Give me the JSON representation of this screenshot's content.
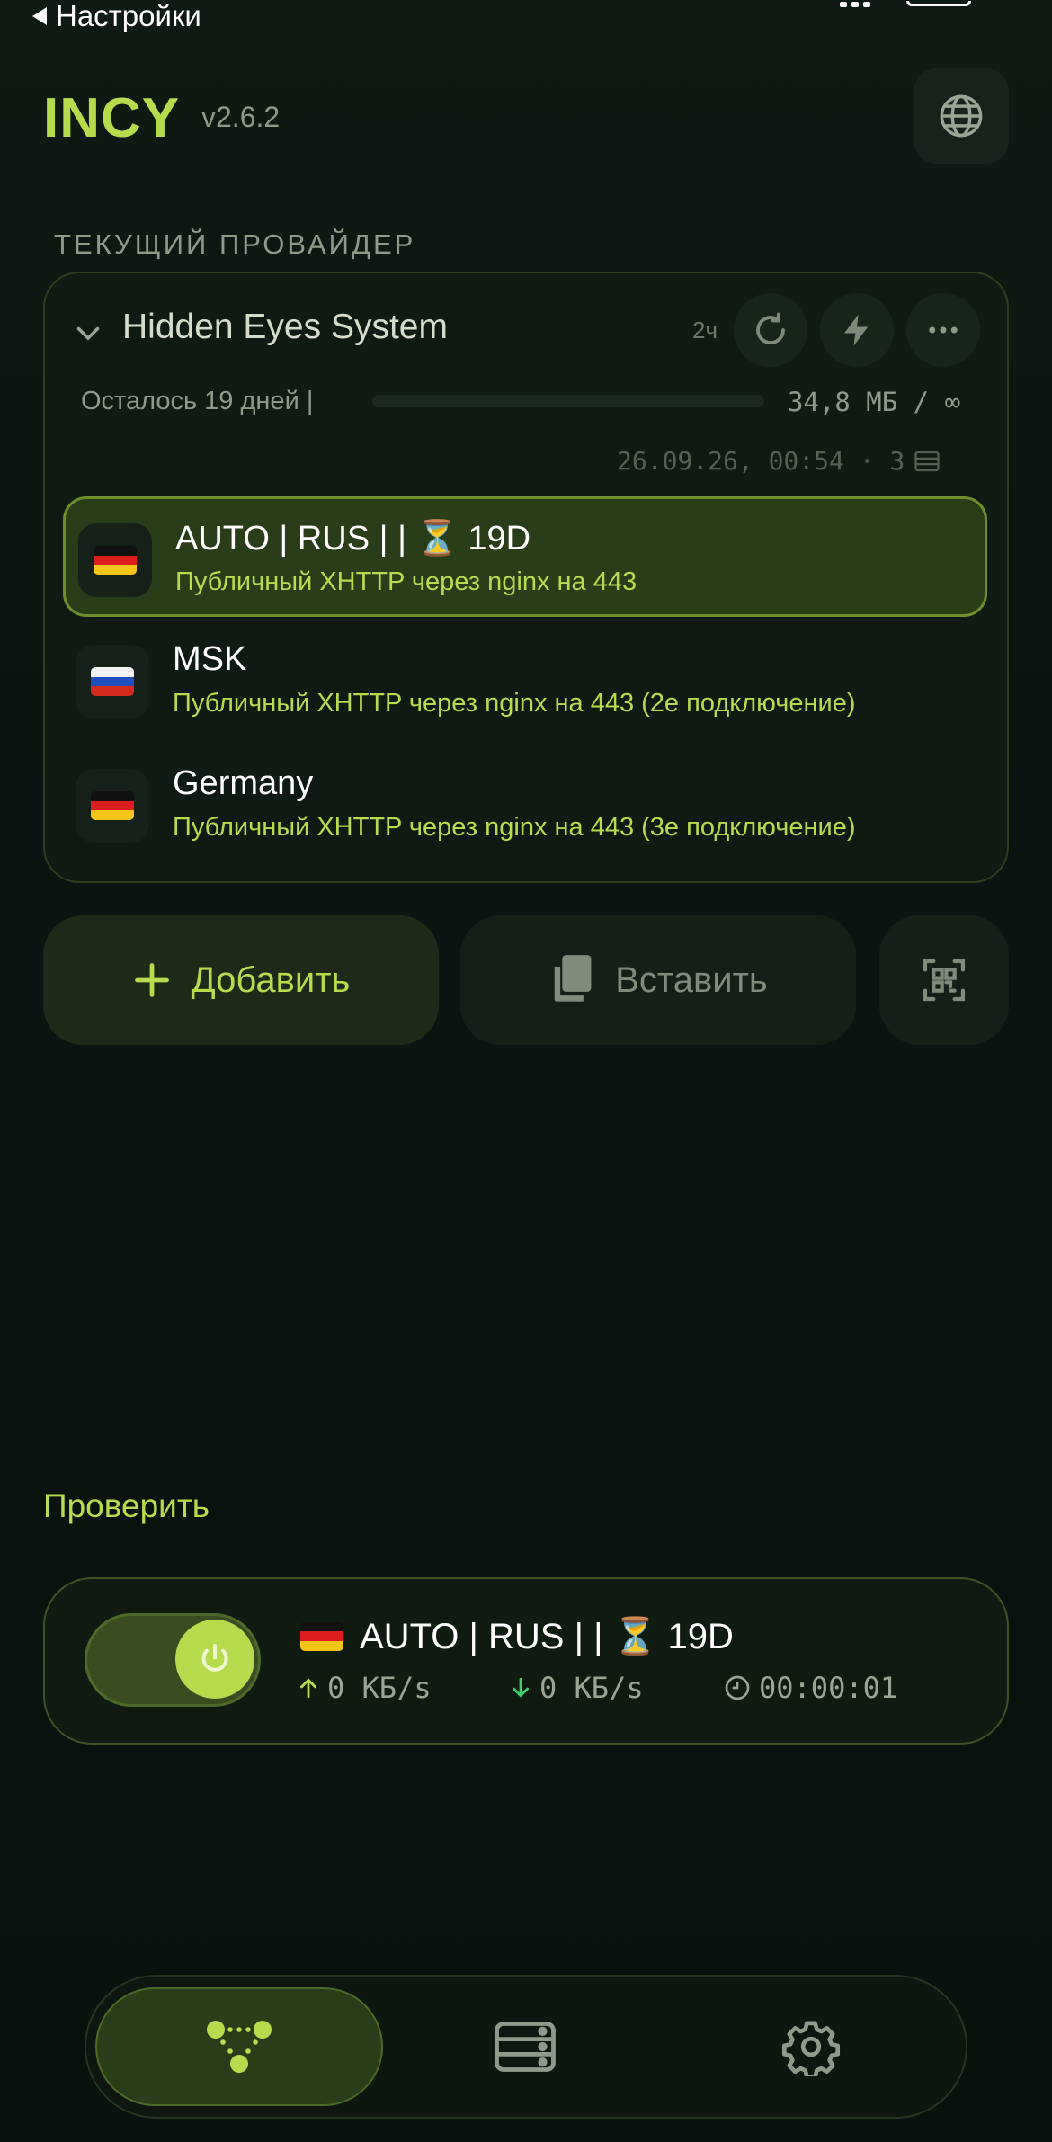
{
  "status_bar": {
    "back_label": "Настройки"
  },
  "header": {
    "brand": "INCY",
    "version": "v2.6.2",
    "language_icon": "globe-icon"
  },
  "section_title": "ТЕКУЩИЙ ПРОВАЙДЕР",
  "provider": {
    "name": "Hidden Eyes System",
    "updated_ago": "2ч",
    "remaining": "Осталось 19 дней  |",
    "traffic": "34,8 МБ / ∞",
    "usage_fraction": 0,
    "updated_at": "26.09.26, 00:54 · 3",
    "servers": [
      {
        "flag": "de",
        "title": "AUTO | RUS | | ⏳ 19D",
        "subtitle": "Публичный XHTTP через nginx на 443",
        "active": true
      },
      {
        "flag": "ru",
        "title": "MSK",
        "subtitle": "Публичный XHTTP через nginx на 443 (2е подключение)",
        "active": false
      },
      {
        "flag": "de",
        "title": "Germany",
        "subtitle": "Публичный XHTTP через nginx на 443 (3е подключение)",
        "active": false
      }
    ]
  },
  "actions": {
    "add_label": "Добавить",
    "paste_label": "Вставить"
  },
  "check_label": "Проверить",
  "connection": {
    "enabled": true,
    "server_title": "AUTO | RUS | | ⏳ 19D",
    "upload": "0 КБ/s",
    "download": "0 КБ/s",
    "duration": "00:00:01"
  },
  "colors": {
    "accent": "#b6dc4e",
    "background": "#0a120d",
    "active_row": "#2a3d19"
  }
}
